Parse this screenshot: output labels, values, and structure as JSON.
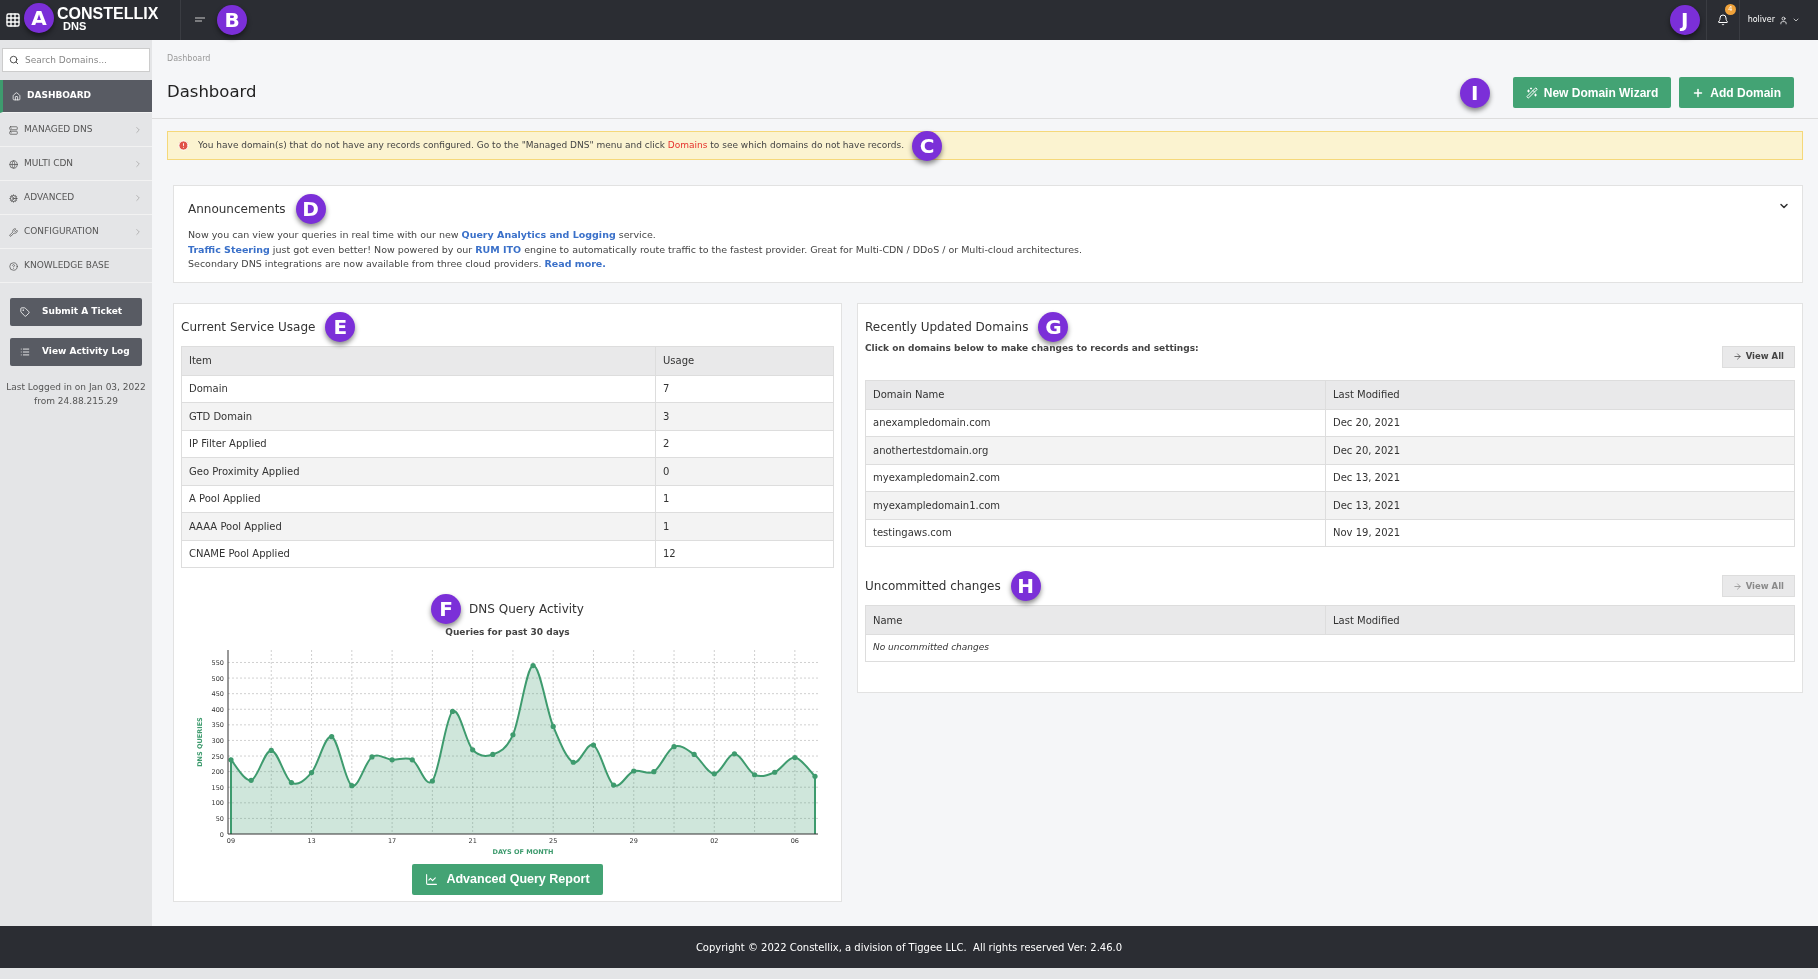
{
  "header": {
    "logo_text": "CONSTELLIX",
    "logo_subtext": "DNS",
    "logo_callout": "A",
    "menu_callout": "B",
    "user_callout": "J",
    "notification_count": "4",
    "username": "holiver"
  },
  "sidebar": {
    "search": {
      "placeholder": "Search Domains..."
    },
    "items": [
      {
        "label": "DASHBOARD",
        "selected": true,
        "expandable": false
      },
      {
        "label": "MANAGED DNS",
        "selected": false,
        "expandable": true
      },
      {
        "label": "MULTI CDN",
        "selected": false,
        "expandable": true
      },
      {
        "label": "ADVANCED",
        "selected": false,
        "expandable": true
      },
      {
        "label": "CONFIGURATION",
        "selected": false,
        "expandable": true
      },
      {
        "label": "KNOWLEDGE BASE",
        "selected": false,
        "expandable": false
      }
    ],
    "buttons": [
      "Submit A Ticket",
      "View Activity Log"
    ],
    "last_login": [
      "Last Logged in on Jan 03, 2022",
      "from 24.88.215.29"
    ]
  },
  "breadcrumb": "Dashboard",
  "page_title": "Dashboard",
  "actions_callout": "I",
  "actions": [
    "New Domain Wizard",
    "Add Domain"
  ],
  "alert": {
    "before": "You have domain(s) that do not have any records configured. Go to the \"Managed DNS\" menu and click ",
    "link": "Domains",
    "after": " to see which domains do not have records.",
    "callout": "C"
  },
  "announcements": {
    "title": "Announcements",
    "callout": "D",
    "expanded": true,
    "lines": [
      [
        {
          "text": "Now you can view your queries in real time with our new ",
          "link": false
        },
        {
          "text": "Query Analytics and Logging",
          "link": true
        },
        {
          "text": " service.",
          "link": false
        }
      ],
      [
        {
          "text": "Traffic Steering",
          "link": true
        },
        {
          "text": " just got even better! Now powered by our ",
          "link": false
        },
        {
          "text": "RUM ITO",
          "link": true
        },
        {
          "text": " engine to automatically route traffic to the fastest provider. Great for Multi-CDN / DDoS / or Multi-cloud architectures.",
          "link": false
        }
      ],
      [
        {
          "text": "Secondary DNS integrations are now available from three cloud providers. ",
          "link": false
        },
        {
          "text": "Read more.",
          "link": true
        }
      ]
    ]
  },
  "usage": {
    "title": "Current Service Usage",
    "callout": "E",
    "columns": [
      "Item",
      "Usage"
    ],
    "rows": [
      [
        "Domain",
        "7"
      ],
      [
        "GTD Domain",
        "3"
      ],
      [
        "IP Filter Applied",
        "2"
      ],
      [
        "Geo Proximity Applied",
        "0"
      ],
      [
        "A Pool Applied",
        "1"
      ],
      [
        "AAAA Pool Applied",
        "1"
      ],
      [
        "CNAME Pool Applied",
        "12"
      ]
    ],
    "activity": {
      "callout": "F",
      "subtitle": "Queries for past 30 days",
      "report_button": "Advanced Query Report",
      "chart_data": {
        "type": "area",
        "title": "DNS Query Activity",
        "xlabel": "DAYS OF MONTH",
        "ylabel": "DNS QUERIES",
        "categories": [
          "09",
          null,
          null,
          null,
          "13",
          null,
          null,
          null,
          "17",
          null,
          null,
          null,
          "21",
          null,
          null,
          null,
          "25",
          null,
          null,
          null,
          "29",
          null,
          null,
          null,
          "02",
          null,
          null,
          null,
          "06",
          null
        ],
        "grid": true,
        "series": [
          {
            "color": "#3e9b6e",
            "values": [
              238,
              172,
              268,
              165,
              197,
              312,
              155,
              247,
              238,
              238,
              170,
              393,
              270,
              255,
              318,
              540,
              345,
              230,
              285,
              157,
              202,
              200,
              280,
              255,
              193,
              257,
              190,
              198,
              245,
              185
            ]
          }
        ],
        "ylim": [
          0,
          590
        ],
        "yticks": [
          0,
          50,
          100,
          150,
          200,
          250,
          300,
          350,
          400,
          450,
          500,
          550
        ]
      }
    }
  },
  "recent": {
    "title": "Recently Updated Domains",
    "callout": "G",
    "subtitle": "Click on domains below to make changes to records and settings:",
    "view_all": {
      "label": "View All",
      "disabled": false
    },
    "columns": [
      "Domain Name",
      "Last Modified"
    ],
    "rows": [
      [
        "anexampledomain.com",
        "Dec 20, 2021"
      ],
      [
        "anothertestdomain.org",
        "Dec 20, 2021"
      ],
      [
        "myexampledomain2.com",
        "Dec 13, 2021"
      ],
      [
        "myexampledomain1.com",
        "Dec 13, 2021"
      ],
      [
        "testingaws.com",
        "Nov 19, 2021"
      ]
    ]
  },
  "uncommitted": {
    "title": "Uncommitted changes",
    "callout": "H",
    "view_all": {
      "label": "View All",
      "disabled": true
    },
    "columns": [
      "Name",
      "Last Modified"
    ],
    "empty_text": "No uncommitted changes"
  },
  "footer": "Copyright © 2022 Constellix, a division of Tiggee LLC.  All rights reserved Ver: 2.46.0"
}
